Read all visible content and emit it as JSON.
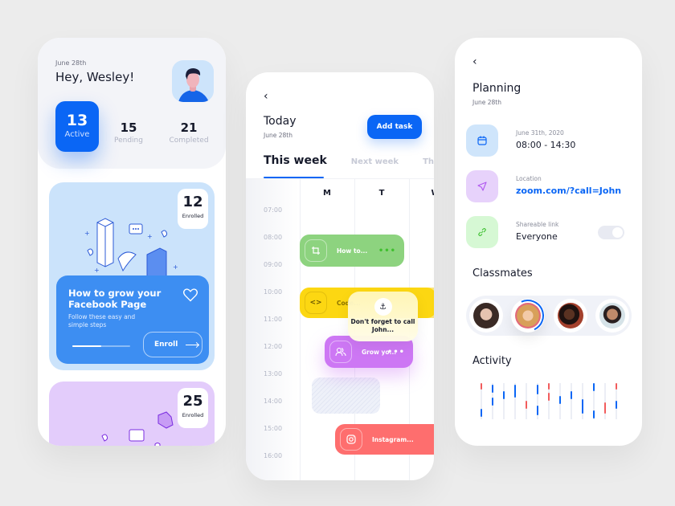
{
  "dashboard": {
    "date": "June 28th",
    "greeting": "Hey, Wesley!",
    "stats": {
      "active": {
        "value": "13",
        "label": "Active"
      },
      "pending": {
        "value": "15",
        "label": "Pending"
      },
      "completed": {
        "value": "21",
        "label": "Completed"
      }
    },
    "courses": [
      {
        "enrolled_count": "12",
        "enrolled_label": "Enrolled",
        "title": "How to grow your Facebook Page",
        "subtitle": "Follow these easy and simple steps",
        "progress": 0.5,
        "enroll_label": "Enroll",
        "color": "#cbe3fb"
      },
      {
        "enrolled_count": "25",
        "enrolled_label": "Enrolled",
        "color": "#e3ccfb"
      }
    ]
  },
  "schedule": {
    "title": "Today",
    "date": "June 28th",
    "add_task_label": "Add task",
    "tabs": [
      {
        "label": "This week",
        "active": true
      },
      {
        "label": "Next week",
        "active": false
      },
      {
        "label": "This month",
        "active": false
      }
    ],
    "days": [
      "M",
      "T",
      "W"
    ],
    "times": [
      "07:00",
      "08:00",
      "09:00",
      "10:00",
      "11:00",
      "12:00",
      "13:00",
      "14:00",
      "15:00",
      "16:00"
    ],
    "events": [
      {
        "title": "How to...",
        "icon": "crop-icon",
        "color": "#8dd37f"
      },
      {
        "title": "Code...",
        "icon": "code-icon",
        "color": "#fcd712"
      },
      {
        "title": "Grow yo...",
        "icon": "users-icon",
        "color": "#cd77f4"
      },
      {
        "title": "Instagram...",
        "icon": "instagram-icon",
        "color": "#fe6e6e"
      }
    ],
    "reminder": {
      "text": "Don't forget to call John...",
      "icon": "anchor-icon"
    }
  },
  "planning": {
    "title": "Planning",
    "date": "June 28th",
    "details": [
      {
        "label": "June 31th, 2020",
        "value": "08:00 - 14:30",
        "icon": "calendar-icon",
        "color": "#cfe5fb"
      },
      {
        "label": "Location",
        "value": "zoom.com/?call=John",
        "icon": "send-icon",
        "color": "#e7d2fb"
      },
      {
        "label": "Shareable link",
        "value": "Everyone",
        "icon": "link-icon",
        "color": "#d6f8d4",
        "toggle_on": true
      }
    ],
    "classmates_title": "Classmates",
    "classmates": [
      {
        "name": "classmate-1",
        "selected": false
      },
      {
        "name": "classmate-2",
        "selected": true
      },
      {
        "name": "classmate-3",
        "selected": false
      },
      {
        "name": "classmate-4",
        "selected": false
      }
    ],
    "activity_title": "Activity"
  }
}
